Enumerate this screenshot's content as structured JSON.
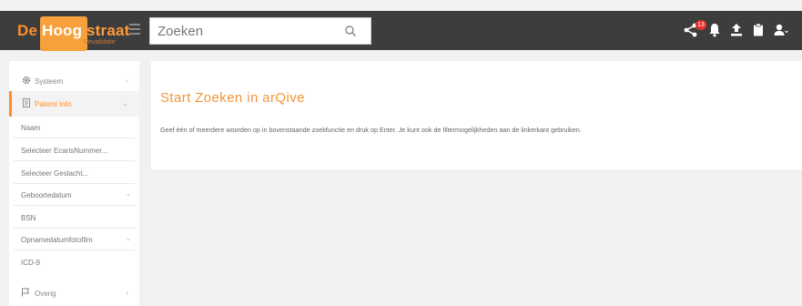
{
  "header": {
    "logo": {
      "part1": "De",
      "part2": "Hoog",
      "part3": "straat",
      "subtitle": "Revalidatie"
    },
    "search": {
      "placeholder": "Zoeken",
      "value": ""
    },
    "notifications_count": "13"
  },
  "sidebar": {
    "systeem": "Systeem",
    "patient_info": "Patient Info",
    "items": [
      {
        "label": "Naam"
      },
      {
        "label": "Selecteer EcarisNummer..."
      },
      {
        "label": "Selecteer Geslacht..."
      },
      {
        "label": "Geboortedatum"
      },
      {
        "label": "BSN"
      },
      {
        "label": "Opnamedatumfotofilm"
      },
      {
        "label": "ICD-9"
      }
    ],
    "overig": "Overig"
  },
  "main": {
    "title": "Start Zoeken in arQive",
    "description": "Geef één of meerdere woorden op in bovenstaande zoekfunctie en druk op Enter. Je kunt ook de filtermogelijkheden aan de linkerkant gebruiken."
  },
  "colors": {
    "accent": "#ff8f2b",
    "topbar": "#3d3d3d",
    "badge": "#e2312d"
  }
}
